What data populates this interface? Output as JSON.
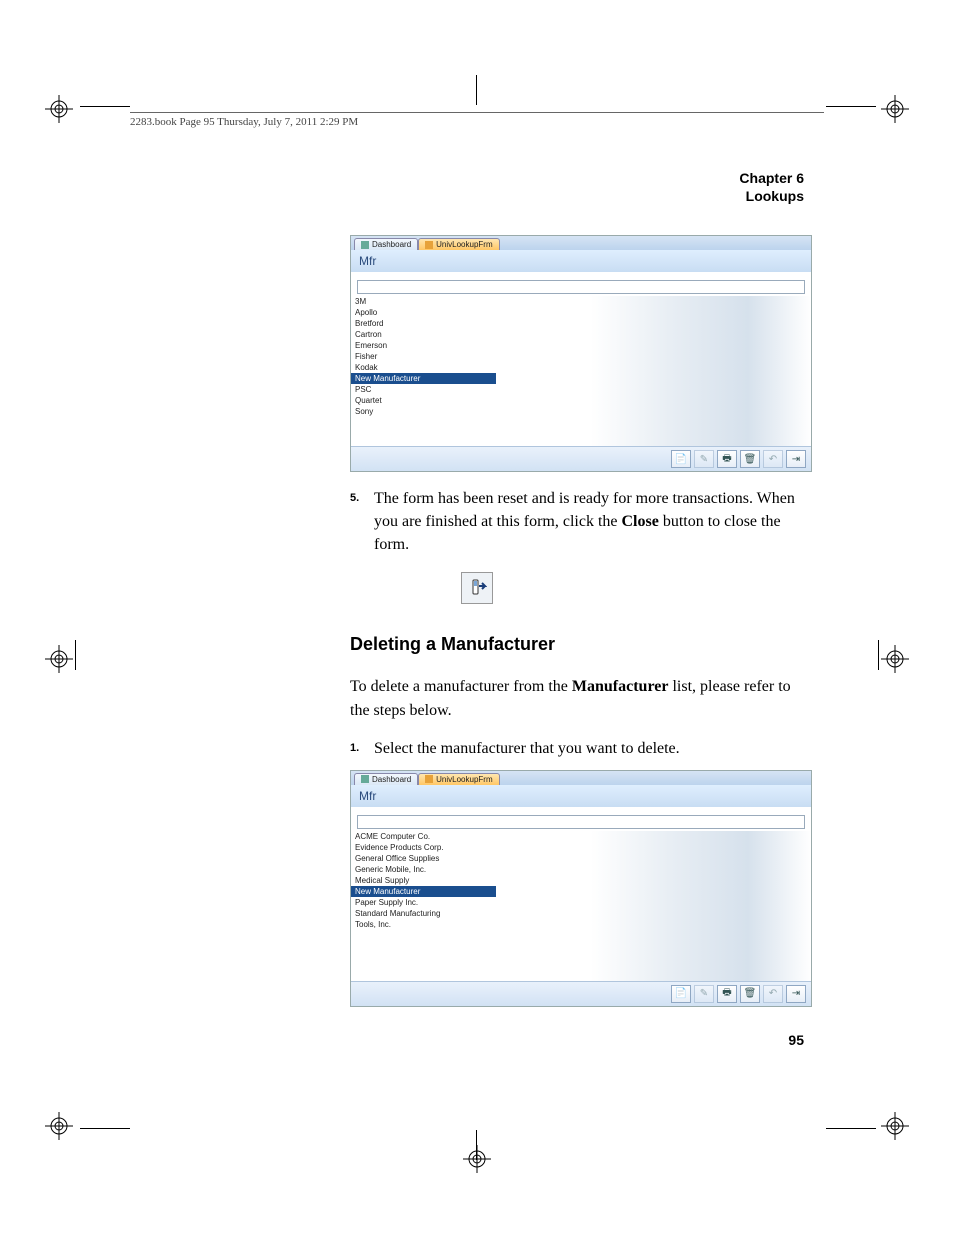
{
  "header": {
    "text": "2283.book  Page 95  Thursday, July 7, 2011  2:29 PM"
  },
  "chapter": {
    "line1": "Chapter 6",
    "line2": "Lookups"
  },
  "screenshot1": {
    "tabs": {
      "inactive": "Dashboard",
      "active": "UnivLookupFrm"
    },
    "title": "Mfr",
    "items": [
      "3M",
      "Apollo",
      "Bretford",
      "Cartron",
      "Emerson",
      "Fisher",
      "Kodak",
      "New Manufacturer",
      "PSC",
      "Quartet",
      "Sony"
    ],
    "selected": "New Manufacturer",
    "filter_placeholder": ""
  },
  "step5": {
    "num": "5.",
    "text_a": "The form has been reset and is ready for more transactions. When you are finished at this form, click the ",
    "text_b": "Close",
    "text_c": " button to close the form."
  },
  "section": {
    "heading": "Deleting a Manufacturer"
  },
  "intro": {
    "a": "To delete a manufacturer from the ",
    "b": "Manufacturer",
    "c": " list, please refer to the steps below."
  },
  "step1": {
    "num": "1.",
    "text": "Select the manufacturer that you want to delete."
  },
  "screenshot2": {
    "tabs": {
      "inactive": "Dashboard",
      "active": "UnivLookupFrm"
    },
    "title": "Mfr",
    "items": [
      "ACME Computer Co.",
      "Evidence Products Corp.",
      "General Office Supplies",
      "Generic Mobile, Inc.",
      "Medical Supply",
      "New Manufacturer",
      "Paper Supply Inc.",
      "Standard Manufacturing",
      "Tools, Inc."
    ],
    "selected": "New Manufacturer",
    "filter_placeholder": ""
  },
  "page": {
    "number": "95"
  },
  "icons": {
    "tool1": "📄",
    "tool2": "✎",
    "tool3": "🖶",
    "tool4": "🗑",
    "tool5": "↶",
    "tool6": "⇥"
  }
}
